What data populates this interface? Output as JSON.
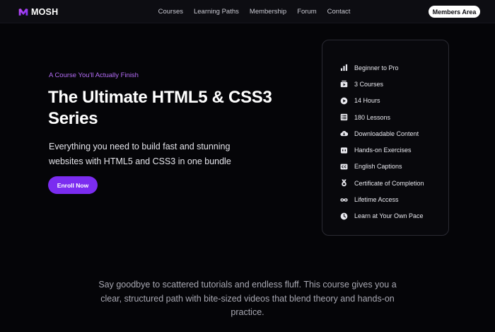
{
  "nav": {
    "logo_text": "MOSH",
    "links": [
      "Courses",
      "Learning Paths",
      "Membership",
      "Forum",
      "Contact"
    ],
    "cta_label": "Members Area"
  },
  "hero": {
    "eyebrow": "A Course You'll Actually Finish",
    "title": "The Ultimate HTML5 & CSS3 Series",
    "description": "Everything you need to build fast and stunning websites with HTML5 and CSS3 in one bundle",
    "cta_label": "Enroll Now"
  },
  "features": [
    {
      "icon": "bar-chart-icon",
      "label": "Beginner to Pro"
    },
    {
      "icon": "courses-icon",
      "label": "3 Courses"
    },
    {
      "icon": "play-icon",
      "label": "14 Hours"
    },
    {
      "icon": "list-icon",
      "label": "180 Lessons"
    },
    {
      "icon": "cloud-download-icon",
      "label": "Downloadable Content"
    },
    {
      "icon": "exercise-icon",
      "label": "Hands-on Exercises"
    },
    {
      "icon": "captions-icon",
      "label": "English Captions"
    },
    {
      "icon": "medal-icon",
      "label": "Certificate of Completion"
    },
    {
      "icon": "infinity-icon",
      "label": "Lifetime Access"
    },
    {
      "icon": "clock-icon",
      "label": "Learn at Your Own Pace"
    }
  ],
  "intro": {
    "text": "Say goodbye to scattered tutorials and endless fluff. This course gives you a clear, structured path with bite-sized videos that blend theory and hands-on practice."
  },
  "colors": {
    "background": "#050508",
    "accent": "#7b2cf0",
    "eyebrow": "#b36cf5"
  }
}
